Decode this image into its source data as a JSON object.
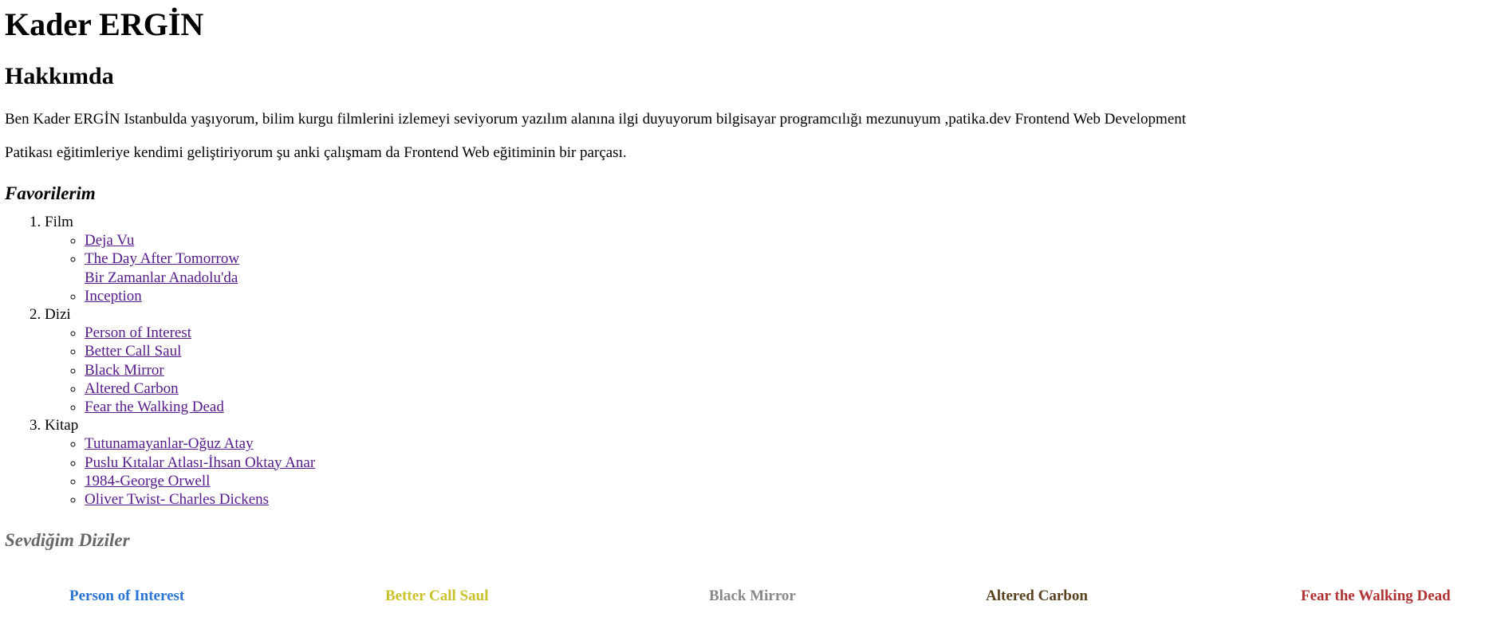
{
  "header": {
    "name": "Kader ERGİN"
  },
  "about": {
    "title": "Hakkımda",
    "paragraph1": "Ben Kader ERGİN Istanbulda yaşıyorum, bilim kurgu filmlerini izlemeyi seviyorum yazılım alanına ilgi duyuyorum bilgisayar programcılığı mezunuyum ,patika.dev Frontend Web Development",
    "paragraph2": "Patikası eğitimleriye kendimi geliştiriyorum şu anki çalışmam da Frontend Web eğitiminin bir parçası."
  },
  "favorites": {
    "title": "Favorilerim",
    "categories": [
      {
        "label": "Film",
        "items": [
          "Deja Vu",
          "The Day After Tomorrow",
          "Bir Zamanlar Anadolu'da",
          "Inception"
        ]
      },
      {
        "label": "Dizi",
        "items": [
          "Person of Interest",
          "Better Call Saul",
          "Black Mirror",
          "Altered Carbon",
          "Fear the Walking Dead"
        ]
      },
      {
        "label": "Kitap",
        "items": [
          "Tutunamayanlar-Oğuz Atay",
          "Puslu Kıtalar Atlası-İhsan Oktay Anar",
          "1984-George Orwell",
          "Oliver Twist- Charles Dickens"
        ]
      }
    ]
  },
  "favorite_series": {
    "title": "Sevdiğim Diziler",
    "items": [
      {
        "label": "Person of Interest",
        "color": "#2a74d4"
      },
      {
        "label": "Better Call Saul",
        "color": "#c9c22a"
      },
      {
        "label": "Black Mirror",
        "color": "#888888"
      },
      {
        "label": "Altered Carbon",
        "color": "#5a4321"
      },
      {
        "label": "Fear the Walking Dead",
        "color": "#b03333"
      }
    ]
  },
  "colors": {
    "link": "#551a8b",
    "subheading_gray": "#666666"
  }
}
